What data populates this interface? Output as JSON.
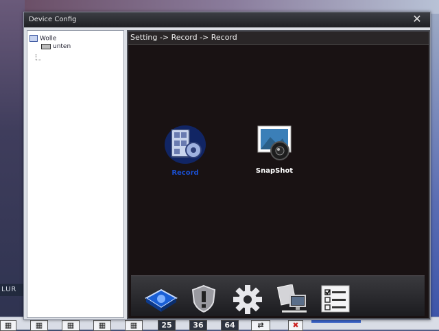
{
  "dialog": {
    "title": "Device Config",
    "close_glyph": "✕"
  },
  "tree": {
    "root_label": "Wolle",
    "child_label": "unten"
  },
  "panel": {
    "breadcrumb": "Setting -> Record -> Record",
    "features": [
      {
        "label": "Record",
        "icon": "record-film-gear-icon",
        "selected": true,
        "color": "#1a4fd0"
      },
      {
        "label": "SnapShot",
        "icon": "snapshot-camera-icon",
        "selected": false,
        "color": "#ffffff"
      }
    ]
  },
  "toolbar": {
    "tools": [
      {
        "icon": "device-cube-icon"
      },
      {
        "icon": "alert-shield-icon"
      },
      {
        "icon": "settings-gear-icon"
      },
      {
        "icon": "network-monitor-icon"
      },
      {
        "icon": "checklist-icon"
      }
    ]
  },
  "background": {
    "side_label": "LUR",
    "strip_numbers": [
      "25",
      "36",
      "64"
    ]
  }
}
